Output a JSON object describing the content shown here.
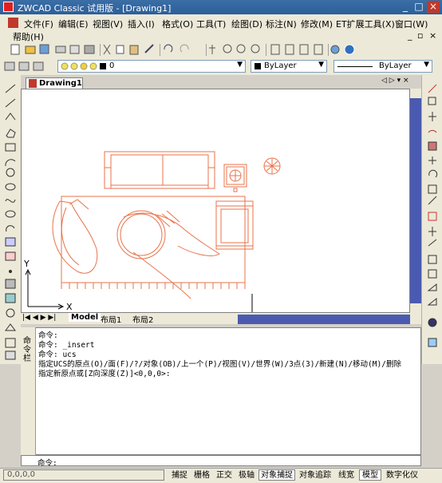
{
  "window": {
    "title": "ZWCAD Classic 试用版 - [Drawing1]",
    "minimize": "_",
    "restore": "□",
    "close": "×"
  },
  "menu": {
    "items": [
      "文件(F)",
      "编辑(E)",
      "视图(V)",
      "插入(I)",
      "格式(O)",
      "工具(T)",
      "绘图(D)",
      "标注(N)",
      "修改(M)",
      "ET扩展工具(X)",
      "窗口(W)"
    ],
    "second_row": "帮助(H)",
    "doc_controls": [
      "_",
      "▫",
      "×"
    ]
  },
  "layer_toolbar": {
    "layer_value": "0",
    "color_value": "ByLayer",
    "linetype_value": "ByLayer"
  },
  "document": {
    "tab_title": "Drawing1",
    "nav": "◁ ▷ ▾ ×"
  },
  "axis": {
    "x_label": "X",
    "y_label": "Y"
  },
  "layout_tabs": [
    "Model",
    "布局1",
    "布局2"
  ],
  "command": {
    "side_label": "命令栏",
    "lines": [
      "命令:",
      "命令: _insert",
      "命令: ucs",
      "指定UCS的原点(O)/面(F)/?/对象(OB)/上一个(P)/视图(V)/世界(W)/3点(3)/新建(N)/移动(M)/删除",
      "指定新原点或[Z向深度(Z)]<0,0,0>:"
    ],
    "prompt": "命令:",
    "close": "×"
  },
  "status": {
    "coords": "0,0,0,0",
    "buttons": [
      {
        "label": "捕捉",
        "on": false
      },
      {
        "label": "栅格",
        "on": false
      },
      {
        "label": "正交",
        "on": false
      },
      {
        "label": "极轴",
        "on": false
      },
      {
        "label": "对象捕捉",
        "on": true
      },
      {
        "label": "对象追踪",
        "on": false
      },
      {
        "label": "线宽",
        "on": false
      },
      {
        "label": "模型",
        "on": true
      },
      {
        "label": "数字化仪",
        "on": false
      }
    ]
  },
  "colors": {
    "drawing": "#e8734a",
    "scroll": "#4a5ab0",
    "titlebar": "#3a6ea5"
  }
}
